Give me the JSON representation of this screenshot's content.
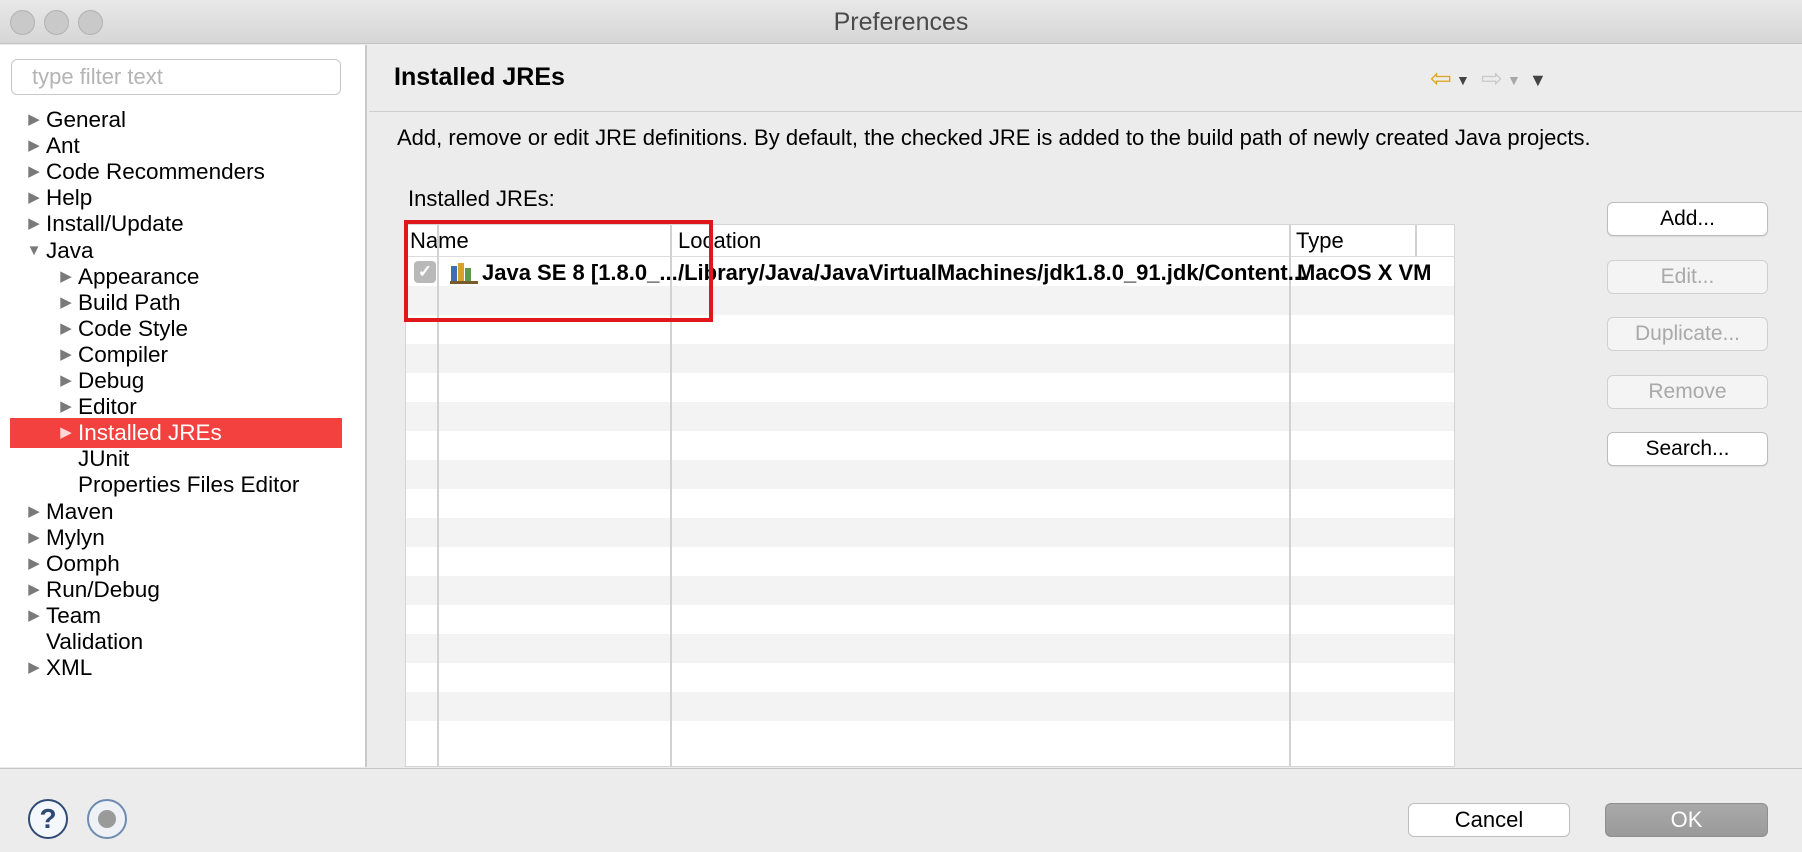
{
  "window": {
    "title": "Preferences"
  },
  "sidebar": {
    "filter_placeholder": "type filter text",
    "items": [
      {
        "label": "General",
        "level": 0,
        "expandable": true,
        "expanded": false
      },
      {
        "label": "Ant",
        "level": 0,
        "expandable": true,
        "expanded": false
      },
      {
        "label": "Code Recommenders",
        "level": 0,
        "expandable": true,
        "expanded": false
      },
      {
        "label": "Help",
        "level": 0,
        "expandable": true,
        "expanded": false
      },
      {
        "label": "Install/Update",
        "level": 0,
        "expandable": true,
        "expanded": false
      },
      {
        "label": "Java",
        "level": 0,
        "expandable": true,
        "expanded": true
      },
      {
        "label": "Appearance",
        "level": 1,
        "expandable": true,
        "expanded": false
      },
      {
        "label": "Build Path",
        "level": 1,
        "expandable": true,
        "expanded": false
      },
      {
        "label": "Code Style",
        "level": 1,
        "expandable": true,
        "expanded": false
      },
      {
        "label": "Compiler",
        "level": 1,
        "expandable": true,
        "expanded": false
      },
      {
        "label": "Debug",
        "level": 1,
        "expandable": true,
        "expanded": false
      },
      {
        "label": "Editor",
        "level": 1,
        "expandable": true,
        "expanded": false
      },
      {
        "label": "Installed JREs",
        "level": 1,
        "expandable": true,
        "expanded": false,
        "selected": true
      },
      {
        "label": "JUnit",
        "level": 1,
        "expandable": false
      },
      {
        "label": "Properties Files Editor",
        "level": 1,
        "expandable": false
      },
      {
        "label": "Maven",
        "level": 0,
        "expandable": true,
        "expanded": false
      },
      {
        "label": "Mylyn",
        "level": 0,
        "expandable": true,
        "expanded": false
      },
      {
        "label": "Oomph",
        "level": 0,
        "expandable": true,
        "expanded": false
      },
      {
        "label": "Run/Debug",
        "level": 0,
        "expandable": true,
        "expanded": false
      },
      {
        "label": "Team",
        "level": 0,
        "expandable": true,
        "expanded": false
      },
      {
        "label": "Validation",
        "level": 0,
        "expandable": false
      },
      {
        "label": "XML",
        "level": 0,
        "expandable": true,
        "expanded": false
      }
    ]
  },
  "main": {
    "title": "Installed JREs",
    "description": "Add, remove or edit JRE definitions. By default, the checked JRE is added to the build path of newly created Java projects.",
    "table_label": "Installed JREs:",
    "columns": [
      "Name",
      "Location",
      "Type"
    ],
    "rows": [
      {
        "checked": true,
        "name": "Java SE 8 [1.8.0_...",
        "location": "/Library/Java/JavaVirtualMachines/jdk1.8.0_91.jdk/Content...",
        "type": "MacOS X VM"
      }
    ],
    "buttons": [
      {
        "label": "Add...",
        "enabled": true
      },
      {
        "label": "Edit...",
        "enabled": false
      },
      {
        "label": "Duplicate...",
        "enabled": false
      },
      {
        "label": "Remove",
        "enabled": false
      },
      {
        "label": "Search...",
        "enabled": true
      }
    ]
  },
  "footer": {
    "cancel_label": "Cancel",
    "ok_label": "OK"
  },
  "colors": {
    "selection": "#f2413f",
    "highlight_box": "#e0181b",
    "back_arrow": "#e0a21a"
  }
}
